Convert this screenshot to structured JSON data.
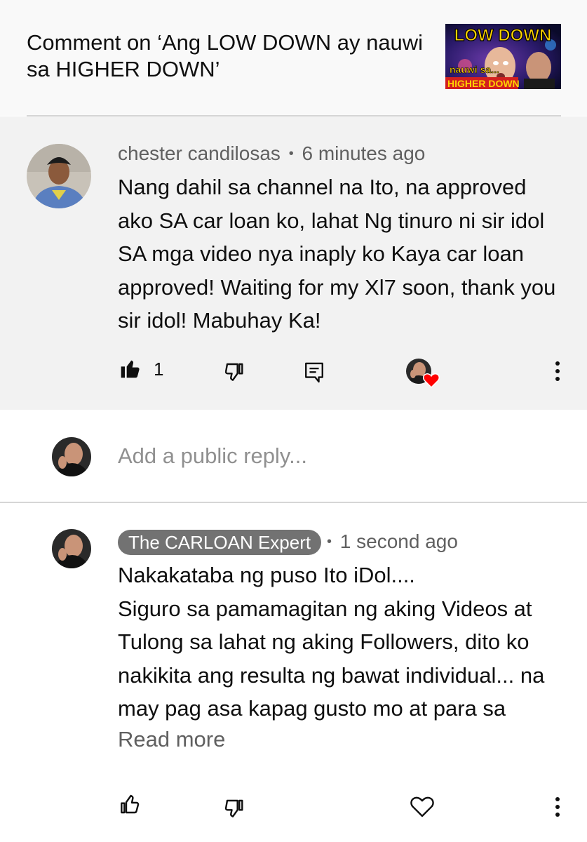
{
  "header": {
    "title": "Comment on ‘Ang LOW DOWN ay nauwi sa HIGHER DOWN’",
    "thumbnail": {
      "top_text": "LOW DOWN",
      "line1": "nauwi sa...",
      "line2": "HIGHER DOWN"
    }
  },
  "comment": {
    "author": "chester candilosas",
    "separator": "•",
    "time": "6 minutes ago",
    "text": "Nang dahil sa channel na Ito, na approved ako SA car loan ko, lahat Ng tinuro ni sir idol SA mga video nya inaply ko Kaya car loan approved! Waiting for my Xl7 soon, thank you sir idol! Mabuhay Ka!",
    "like_count": "1",
    "icons": [
      "thumbs-up-filled-icon",
      "thumbs-down-icon",
      "reply-icon",
      "creator-heart-icon",
      "more-vert-icon"
    ]
  },
  "reply_box": {
    "placeholder": "Add a public reply..."
  },
  "reply": {
    "author": "The CARLOAN Expert",
    "separator": "•",
    "time": "1 second ago",
    "text": "Nakakataba ng puso Ito iDol....\nSiguro sa pamamagitan ng aking Videos at Tulong sa lahat ng aking Followers, dito ko nakikita ang resulta ng bawat individual... na may pag asa kapag gusto mo at para sa",
    "read_more": "Read more",
    "icons": [
      "thumbs-up-icon",
      "thumbs-down-icon",
      "heart-icon",
      "more-vert-icon"
    ]
  },
  "colors": {
    "header_bg": "#f9f9f9",
    "comment_bg": "#f2f2f2",
    "badge_bg": "#727272",
    "heart": "#ff0000",
    "secondary_text": "#606060"
  }
}
